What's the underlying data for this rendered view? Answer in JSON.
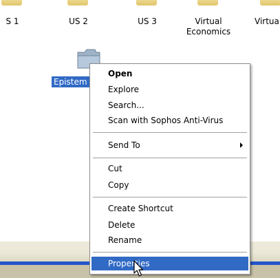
{
  "desktop": {
    "icons_top": [
      {
        "label": "S 1"
      },
      {
        "label": "US 2"
      },
      {
        "label": "US 3"
      },
      {
        "label_line1": "Virtual",
        "label_line2": "Economics"
      },
      {
        "label": "Virtua"
      }
    ],
    "selected_folder_label": "Epistem"
  },
  "context_menu": {
    "items": [
      {
        "label": "Open"
      },
      {
        "label": "Explore"
      },
      {
        "label": "Search..."
      },
      {
        "label": "Scan with Sophos Anti-Virus"
      },
      {
        "label": "Send To"
      },
      {
        "label": "Cut"
      },
      {
        "label": "Copy"
      },
      {
        "label": "Create Shortcut"
      },
      {
        "label": "Delete"
      },
      {
        "label": "Rename"
      },
      {
        "label": "Properties"
      }
    ]
  },
  "colors": {
    "selection": "#316ac5",
    "folder_fill": "#9fb3c8",
    "taskbar_blue": "#2356c9"
  },
  "icons": [
    "folder-icon",
    "submenu-arrow-icon",
    "pointer-cursor-icon"
  ]
}
